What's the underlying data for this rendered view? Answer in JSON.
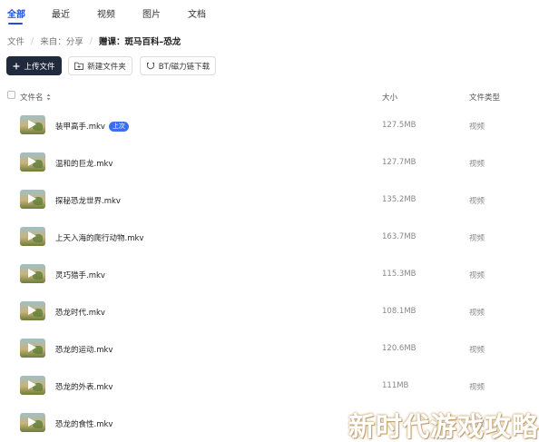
{
  "tabs": [
    {
      "label": "全部",
      "active": true
    },
    {
      "label": "最近",
      "active": false
    },
    {
      "label": "视频",
      "active": false
    },
    {
      "label": "图片",
      "active": false
    },
    {
      "label": "文档",
      "active": false
    }
  ],
  "breadcrumb": {
    "root": "文件",
    "from": "来自：分享",
    "current": "赠课：斑马百科–恐龙"
  },
  "toolbar": {
    "upload_label": "上传文件",
    "new_folder_label": "新建文件夹",
    "bt_label": "BT/磁力链下载"
  },
  "table": {
    "headers": {
      "name": "文件名",
      "size": "大小",
      "type": "文件类型"
    },
    "rows": [
      {
        "name": "装甲高手.mkv",
        "badge": "上次",
        "size": "127.5MB",
        "type": "视频"
      },
      {
        "name": "温和的巨龙.mkv",
        "badge": "",
        "size": "127.7MB",
        "type": "视频"
      },
      {
        "name": "探秘恐龙世界.mkv",
        "badge": "",
        "size": "135.2MB",
        "type": "视频"
      },
      {
        "name": "上天入海的爬行动物.mkv",
        "badge": "",
        "size": "163.7MB",
        "type": "视频"
      },
      {
        "name": "灵巧猎手.mkv",
        "badge": "",
        "size": "115.3MB",
        "type": "视频"
      },
      {
        "name": "恐龙时代.mkv",
        "badge": "",
        "size": "108.1MB",
        "type": "视频"
      },
      {
        "name": "恐龙的运动.mkv",
        "badge": "",
        "size": "120.6MB",
        "type": "视频"
      },
      {
        "name": "恐龙的外表.mkv",
        "badge": "",
        "size": "111MB",
        "type": "视频"
      },
      {
        "name": "恐龙的食性.mkv",
        "badge": "",
        "size": "",
        "type": "视频"
      }
    ]
  },
  "watermark": "新时代游戏攻略",
  "colors": {
    "accent": "#1f4fd8",
    "primary_button": "#1f2a3c",
    "badge": "#3b6ff0"
  }
}
